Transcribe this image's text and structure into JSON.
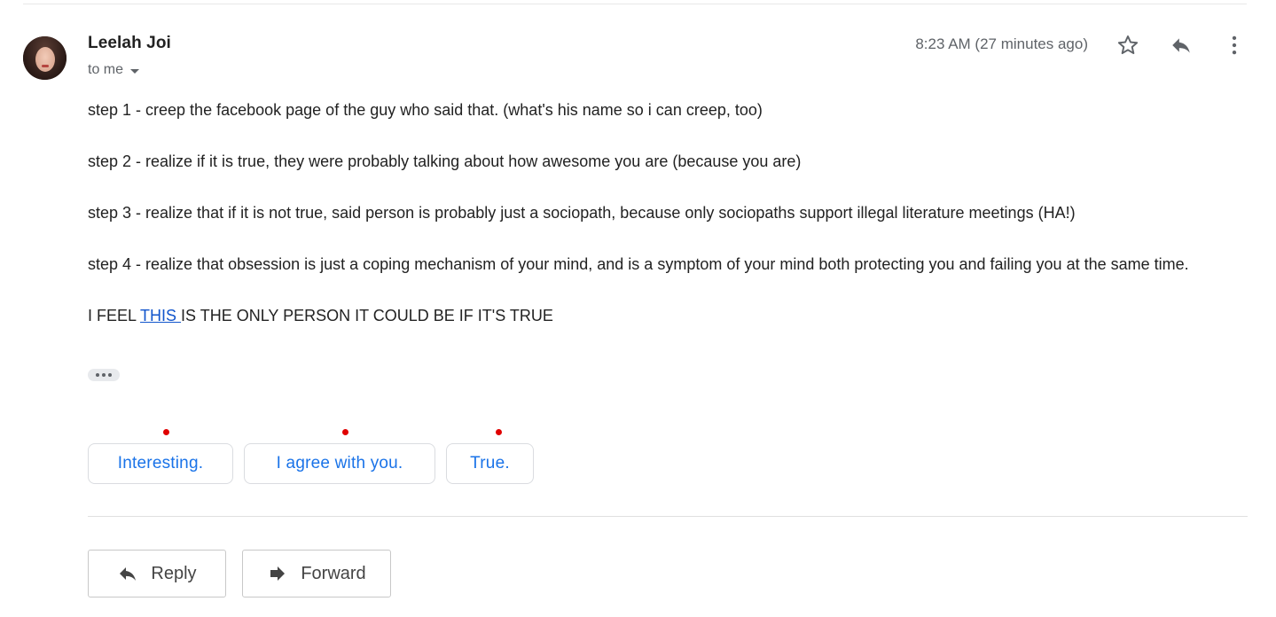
{
  "message": {
    "sender_name": "Leelah Joi",
    "recipient_label": "to me",
    "timestamp": "8:23 AM (27 minutes ago)",
    "body": {
      "step1": "step 1 - creep the facebook page of the guy who said that. (what's his name so i can creep, too)",
      "step2": "step 2 - realize if it is true, they were probably talking about how awesome you are (because you are)",
      "step3": "step 3 - realize that if it is not true, said person is probably just a sociopath, because only sociopaths support illegal literature meetings (HA!)",
      "step4": "step 4 - realize that obsession is just a coping mechanism of your mind, and is a symptom of your mind both protecting you and failing you at the same time.",
      "final_prefix": "I FEEL ",
      "final_link": "THIS ",
      "final_suffix": "IS THE ONLY PERSON IT COULD BE IF IT'S TRUE"
    }
  },
  "header_icons": {
    "star": "star-icon",
    "reply": "reply-icon",
    "more": "more-vert-icon"
  },
  "smart_replies": [
    {
      "label": "Interesting."
    },
    {
      "label": "I agree with you."
    },
    {
      "label": "True."
    }
  ],
  "actions": {
    "reply_label": "Reply",
    "forward_label": "Forward"
  },
  "colors": {
    "link": "#1155cc",
    "smart_reply_text": "#1a73e8",
    "marker": "#e00000",
    "secondary_text": "#5f6368"
  }
}
